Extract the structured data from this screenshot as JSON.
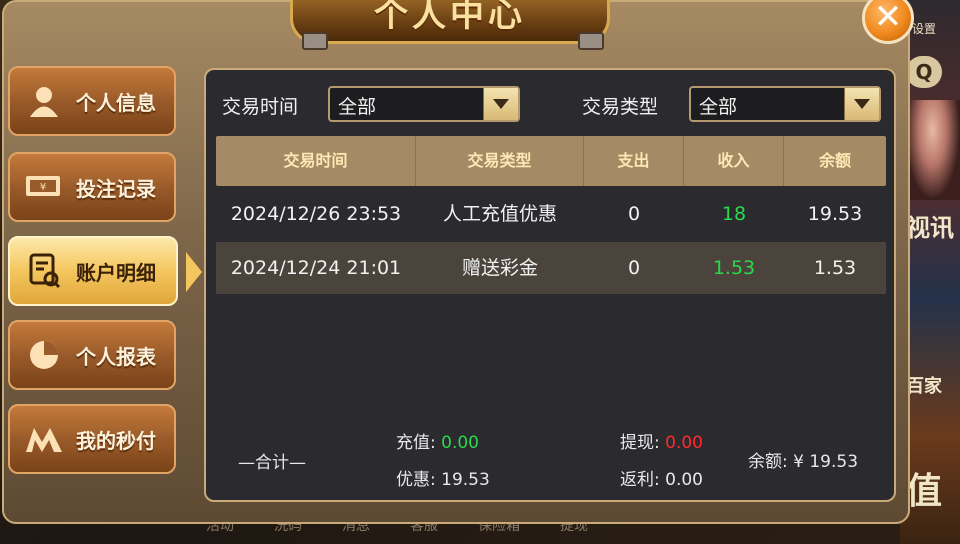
{
  "title": "个人中心",
  "background": {
    "settings_label": "设置",
    "side_text_1": "视讯",
    "side_text_2": "百家",
    "side_text_3": "值",
    "bottom_nav": [
      "活动",
      "洗码",
      "消息",
      "客服",
      "保险箱",
      "提现"
    ]
  },
  "sidebar": {
    "items": [
      {
        "label": "个人信息",
        "icon": "user-icon",
        "active": false
      },
      {
        "label": "投注记录",
        "icon": "cash-icon",
        "active": false
      },
      {
        "label": "账户明细",
        "icon": "document-search-icon",
        "active": true
      },
      {
        "label": "个人报表",
        "icon": "pie-chart-icon",
        "active": false
      },
      {
        "label": "我的秒付",
        "icon": "m-logo-icon",
        "active": false
      }
    ]
  },
  "filters": {
    "time_label": "交易时间",
    "time_value": "全部",
    "type_label": "交易类型",
    "type_value": "全部"
  },
  "table": {
    "headers": [
      "交易时间",
      "交易类型",
      "支出",
      "收入",
      "余额"
    ],
    "rows": [
      {
        "time": "2024/12/26 23:53",
        "type": "人工充值优惠",
        "expense": "0",
        "income": "18",
        "balance": "19.53"
      },
      {
        "time": "2024/12/24 21:01",
        "type": "赠送彩金",
        "expense": "0",
        "income": "1.53",
        "balance": "1.53"
      }
    ]
  },
  "summary": {
    "total_label": "—合计—",
    "recharge_label": "充值:",
    "recharge_value": "0.00",
    "discount_label": "优惠:",
    "discount_value": "19.53",
    "withdraw_label": "提现:",
    "withdraw_value": "0.00",
    "rebate_label": "返利:",
    "rebate_value": "0.00",
    "balance_label": "余额:",
    "balance_value": "¥ 19.53"
  },
  "colors": {
    "income": "#29d94a",
    "withdraw": "#ff2a2a",
    "accent": "#f4c65f"
  }
}
